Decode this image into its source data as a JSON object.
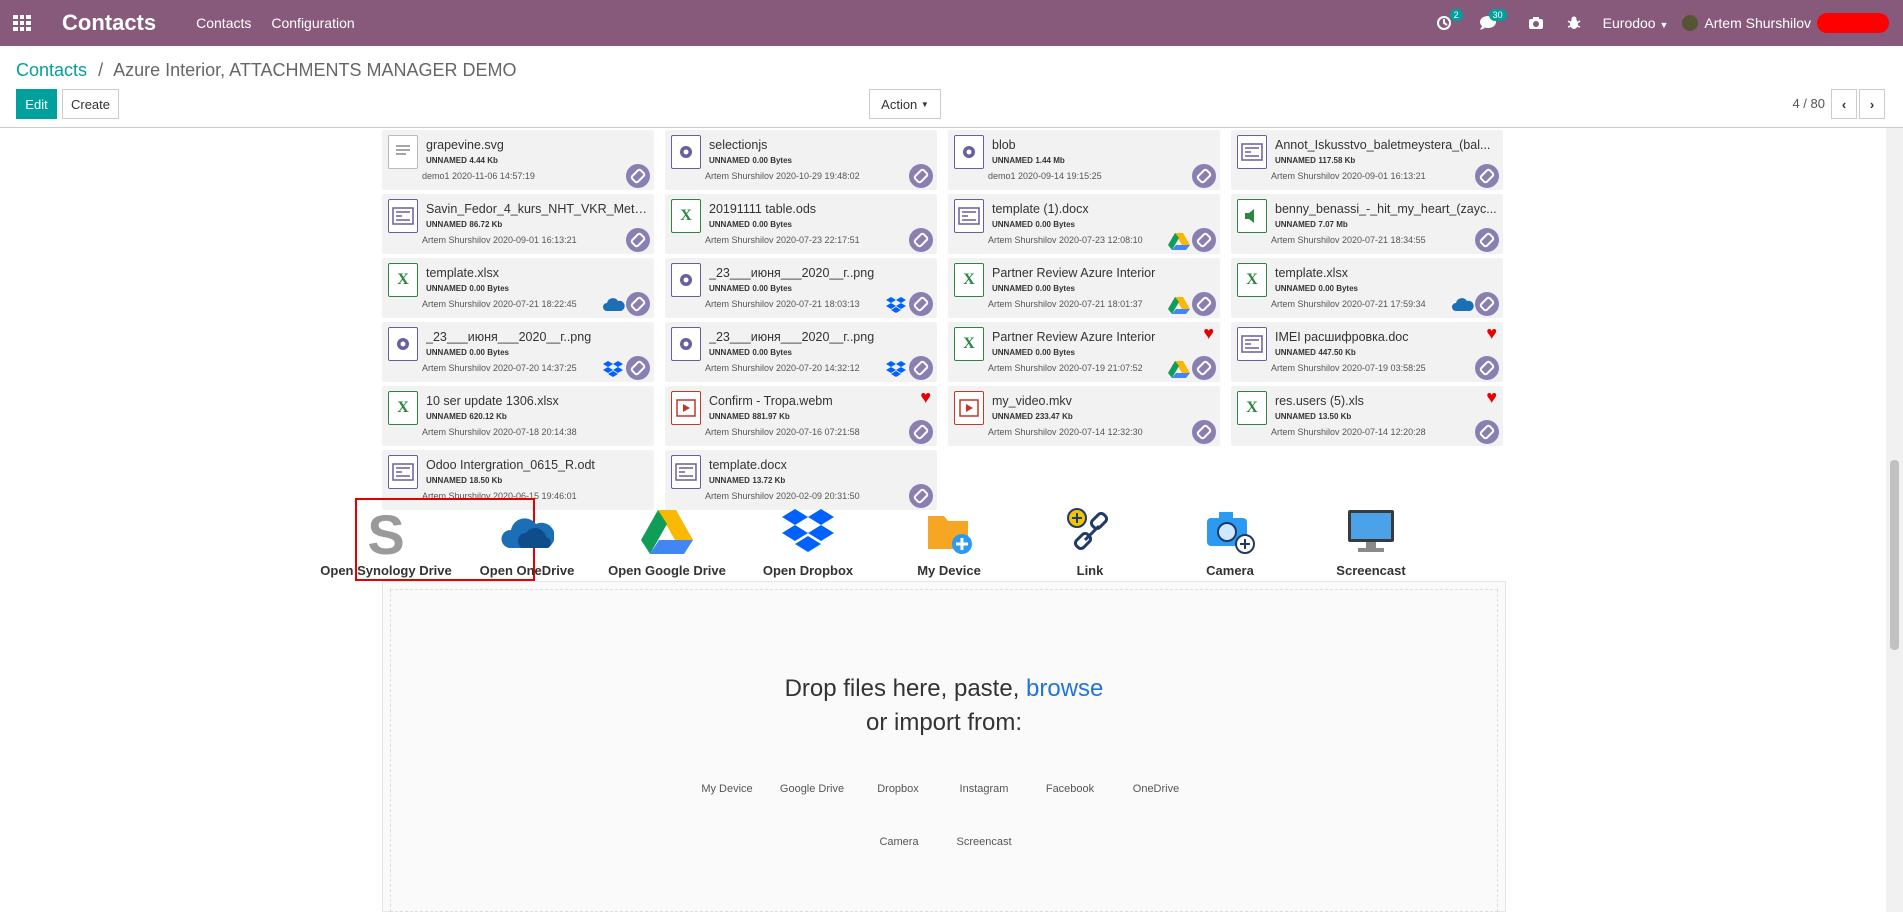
{
  "navbar": {
    "brand": "Contacts",
    "menu": [
      "Contacts",
      "Configuration"
    ],
    "activity_count": "2",
    "messages_count": "30",
    "company": "Eurodoo",
    "user": "Artem Shurshilov"
  },
  "control_panel": {
    "breadcrumb_root": "Contacts",
    "breadcrumb_separator": "/",
    "breadcrumb_current": "Azure Interior, ATTACHMENTS MANAGER DEMO",
    "edit_label": "Edit",
    "create_label": "Create",
    "action_label": "Action",
    "pager_value": "4 / 80"
  },
  "attachments": [
    {
      "name": "grapevine.svg",
      "tag": "UNNAMED",
      "size": "4.44 Kb",
      "author": "demo1 2020-11-06 14:57:19",
      "icon": "text-file-icon",
      "extra": ""
    },
    {
      "name": "selectionjs",
      "tag": "UNNAMED",
      "size": "0.00 Bytes",
      "author": "Artem Shurshilov 2020-10-29 19:48:02",
      "icon": "gear-file-icon",
      "extra": ""
    },
    {
      "name": "blob",
      "tag": "UNNAMED",
      "size": "1.44 Mb",
      "author": "demo1 2020-09-14 19:15:25",
      "icon": "gear-file-icon",
      "extra": ""
    },
    {
      "name": "Annot_Iskusstvo_baletmeystera_(bal...",
      "tag": "UNNAMED",
      "size": "117.58 Kb",
      "author": "Artem Shurshilov 2020-09-01 16:13:21",
      "icon": "image-file-icon",
      "extra": ""
    },
    {
      "name": "Savin_Fedor_4_kurs_NHT_VKR_Meto...",
      "tag": "UNNAMED",
      "size": "86.72 Kb",
      "author": "Artem Shurshilov 2020-09-01 16:13:21",
      "icon": "image-file-icon",
      "extra": ""
    },
    {
      "name": "20191111 table.ods",
      "tag": "UNNAMED",
      "size": "0.00 Bytes",
      "author": "Artem Shurshilov 2020-07-23 22:17:51",
      "icon": "spreadsheet-file-icon",
      "extra": ""
    },
    {
      "name": "template (1).docx",
      "tag": "UNNAMED",
      "size": "0.00 Bytes",
      "author": "Artem Shurshilov 2020-07-23 12:08:10",
      "icon": "image-file-icon",
      "extra": "gdrive"
    },
    {
      "name": "benny_benassi_-_hit_my_heart_(zayc...",
      "tag": "UNNAMED",
      "size": "7.07 Mb",
      "author": "Artem Shurshilov 2020-07-21 18:34:55",
      "icon": "audio-file-icon",
      "extra": ""
    },
    {
      "name": "template.xlsx",
      "tag": "UNNAMED",
      "size": "0.00 Bytes",
      "author": "Artem Shurshilov 2020-07-21 18:22:45",
      "icon": "spreadsheet-file-icon",
      "extra": "onedrive"
    },
    {
      "name": "_23___июня___2020__г..png",
      "tag": "UNNAMED",
      "size": "0.00 Bytes",
      "author": "Artem Shurshilov 2020-07-21 18:03:13",
      "icon": "gear-file-icon",
      "extra": "dropbox"
    },
    {
      "name": "Partner Review Azure Interior",
      "tag": "UNNAMED",
      "size": "0.00 Bytes",
      "author": "Artem Shurshilov 2020-07-21 18:01:37",
      "icon": "spreadsheet-file-icon",
      "extra": "gdrive"
    },
    {
      "name": "template.xlsx",
      "tag": "UNNAMED",
      "size": "0.00 Bytes",
      "author": "Artem Shurshilov 2020-07-21 17:59:34",
      "icon": "spreadsheet-file-icon",
      "extra": "onedrive"
    },
    {
      "name": "_23___июня___2020__г..png",
      "tag": "UNNAMED",
      "size": "0.00 Bytes",
      "author": "Artem Shurshilov 2020-07-20 14:37:25",
      "icon": "gear-file-icon",
      "extra": "dropbox"
    },
    {
      "name": "_23___июня___2020__г..png",
      "tag": "UNNAMED",
      "size": "0.00 Bytes",
      "author": "Artem Shurshilov 2020-07-20 14:32:12",
      "icon": "gear-file-icon",
      "extra": "dropbox"
    },
    {
      "name": "Partner Review Azure Interior",
      "tag": "UNNAMED",
      "size": "0.00 Bytes",
      "author": "Artem Shurshilov 2020-07-19 21:07:52",
      "icon": "spreadsheet-file-icon",
      "extra": "gdrive",
      "fav": true
    },
    {
      "name": "IMEI расшифровка.doc",
      "tag": "UNNAMED",
      "size": "447.50 Kb",
      "author": "Artem Shurshilov 2020-07-19 03:58:25",
      "icon": "image-file-icon",
      "extra": "",
      "fav": true
    },
    {
      "name": "10 ser update 1306.xlsx",
      "tag": "UNNAMED",
      "size": "620.12 Kb",
      "author": "Artem Shurshilov 2020-07-18 20:14:38",
      "icon": "spreadsheet-file-icon",
      "extra": "nolink"
    },
    {
      "name": "Confirm - Tropa.webm",
      "tag": "UNNAMED",
      "size": "881.97 Kb",
      "author": "Artem Shurshilov 2020-07-16 07:21:58",
      "icon": "video-file-icon",
      "extra": "",
      "fav": true
    },
    {
      "name": "my_video.mkv",
      "tag": "UNNAMED",
      "size": "233.47 Kb",
      "author": "Artem Shurshilov 2020-07-14 12:32:30",
      "icon": "video-file-icon",
      "extra": ""
    },
    {
      "name": "res.users (5).xls",
      "tag": "UNNAMED",
      "size": "13.50 Kb",
      "author": "Artem Shurshilov 2020-07-14 12:20:28",
      "icon": "spreadsheet-file-icon",
      "extra": "",
      "fav": true
    },
    {
      "name": "Odoo Intergration_0615_R.odt",
      "tag": "UNNAMED",
      "size": "18.50 Kb",
      "author": "Artem Shurshilov 2020-06-15 19:46:01",
      "icon": "image-file-icon",
      "extra": "nolink"
    },
    {
      "name": "template.docx",
      "tag": "UNNAMED",
      "size": "13.72 Kb",
      "author": "Artem Shurshilov 2020-02-09 20:31:50",
      "icon": "image-file-icon",
      "extra": ""
    }
  ],
  "providers": [
    {
      "label": "Open Synology Drive",
      "icon": "synology-icon"
    },
    {
      "label": "Open OneDrive",
      "icon": "onedrive-icon"
    },
    {
      "label": "Open Google Drive",
      "icon": "google-drive-icon"
    },
    {
      "label": "Open Dropbox",
      "icon": "dropbox-icon"
    },
    {
      "label": "My Device",
      "icon": "folder-icon"
    },
    {
      "label": "Link",
      "icon": "link-icon"
    },
    {
      "label": "Camera",
      "icon": "camera-icon"
    },
    {
      "label": "Screencast",
      "icon": "monitor-icon"
    }
  ],
  "dropzone": {
    "text_before": "Drop files here, paste, ",
    "browse": "browse",
    "line2": "or import from:",
    "sources": [
      "My Device",
      "Google Drive",
      "Dropbox",
      "Instagram",
      "Facebook",
      "OneDrive",
      "Camera",
      "Screencast"
    ]
  },
  "colors": {
    "navbar": "#875a7b",
    "primary": "#00a09d",
    "link_badge": "#8a7fb1",
    "highlight": "#e40000",
    "browse": "#2275d7"
  }
}
